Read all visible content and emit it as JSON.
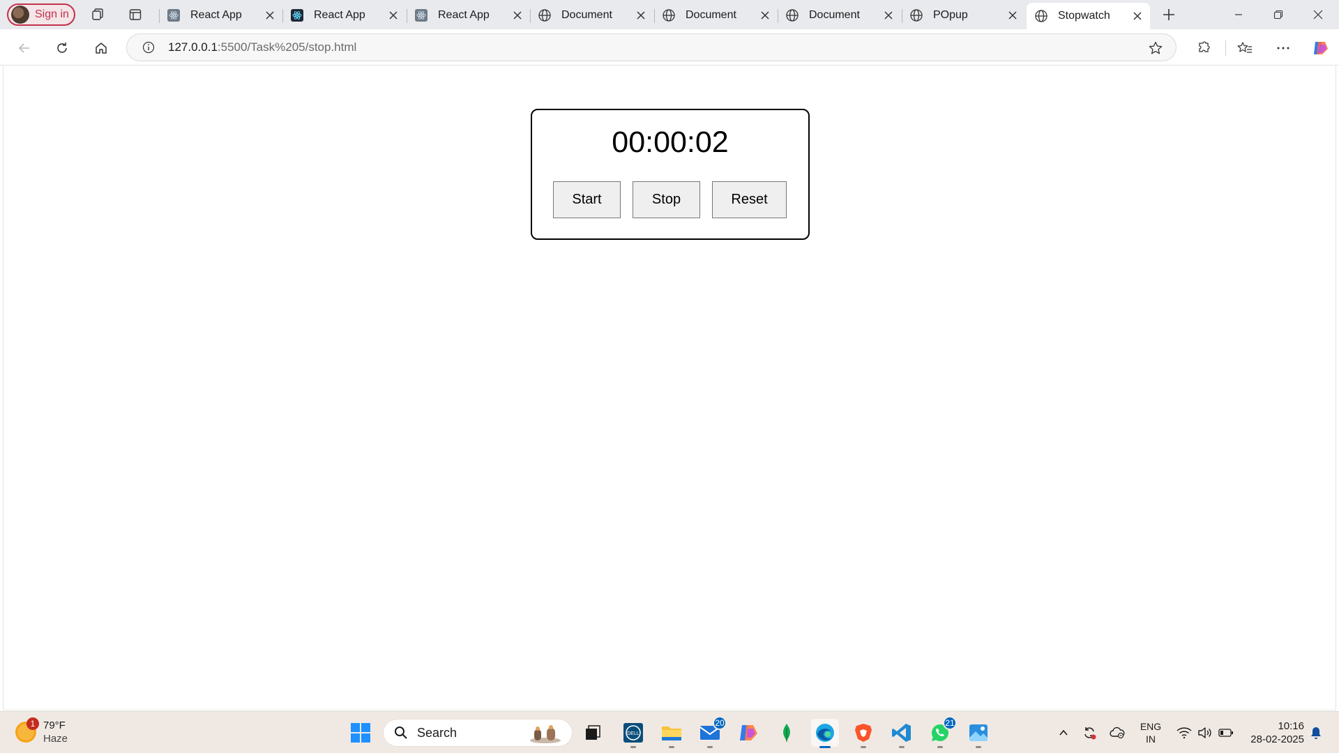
{
  "browser": {
    "signin_label": "Sign in",
    "tabs": [
      {
        "title": "React App",
        "favicon": "react-icon"
      },
      {
        "title": "React App",
        "favicon": "react-icon"
      },
      {
        "title": "React App",
        "favicon": "react-icon"
      },
      {
        "title": "Document",
        "favicon": "globe-icon"
      },
      {
        "title": "Document",
        "favicon": "globe-icon"
      },
      {
        "title": "Document",
        "favicon": "globe-icon"
      },
      {
        "title": "POpup",
        "favicon": "globe-icon"
      },
      {
        "title": "Stopwatch",
        "favicon": "globe-icon",
        "active": true
      }
    ],
    "url": {
      "host": "127.0.0.1",
      "path": ":5500/Task%205/stop.html"
    }
  },
  "stopwatch": {
    "time": "00:00:02",
    "buttons": {
      "start": "Start",
      "stop": "Stop",
      "reset": "Reset"
    }
  },
  "taskbar": {
    "weather": {
      "temp": "79°F",
      "condition": "Haze",
      "badge": "1"
    },
    "search_label": "Search",
    "mail_badge": "20",
    "whatsapp_badge": "21",
    "language": {
      "line1": "ENG",
      "line2": "IN"
    },
    "clock": {
      "time": "10:16",
      "date": "28-02-2025"
    }
  },
  "colors": {
    "accent": "#0067c0",
    "signin": "#c4314b",
    "tab_strip": "#e8eaed",
    "taskbar": "#f0e9e3"
  }
}
